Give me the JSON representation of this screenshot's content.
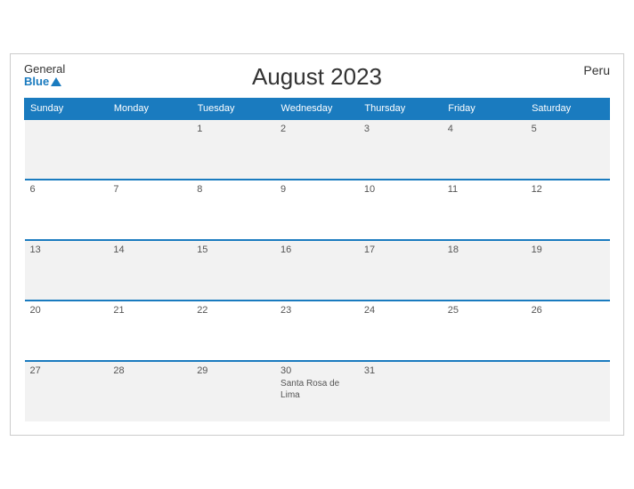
{
  "header": {
    "title": "August 2023",
    "country": "Peru",
    "logo_general": "General",
    "logo_blue": "Blue"
  },
  "weekdays": [
    "Sunday",
    "Monday",
    "Tuesday",
    "Wednesday",
    "Thursday",
    "Friday",
    "Saturday"
  ],
  "weeks": [
    [
      {
        "day": "",
        "event": ""
      },
      {
        "day": "",
        "event": ""
      },
      {
        "day": "1",
        "event": ""
      },
      {
        "day": "2",
        "event": ""
      },
      {
        "day": "3",
        "event": ""
      },
      {
        "day": "4",
        "event": ""
      },
      {
        "day": "5",
        "event": ""
      }
    ],
    [
      {
        "day": "6",
        "event": ""
      },
      {
        "day": "7",
        "event": ""
      },
      {
        "day": "8",
        "event": ""
      },
      {
        "day": "9",
        "event": ""
      },
      {
        "day": "10",
        "event": ""
      },
      {
        "day": "11",
        "event": ""
      },
      {
        "day": "12",
        "event": ""
      }
    ],
    [
      {
        "day": "13",
        "event": ""
      },
      {
        "day": "14",
        "event": ""
      },
      {
        "day": "15",
        "event": ""
      },
      {
        "day": "16",
        "event": ""
      },
      {
        "day": "17",
        "event": ""
      },
      {
        "day": "18",
        "event": ""
      },
      {
        "day": "19",
        "event": ""
      }
    ],
    [
      {
        "day": "20",
        "event": ""
      },
      {
        "day": "21",
        "event": ""
      },
      {
        "day": "22",
        "event": ""
      },
      {
        "day": "23",
        "event": ""
      },
      {
        "day": "24",
        "event": ""
      },
      {
        "day": "25",
        "event": ""
      },
      {
        "day": "26",
        "event": ""
      }
    ],
    [
      {
        "day": "27",
        "event": ""
      },
      {
        "day": "28",
        "event": ""
      },
      {
        "day": "29",
        "event": ""
      },
      {
        "day": "30",
        "event": "Santa Rosa de Lima"
      },
      {
        "day": "31",
        "event": ""
      },
      {
        "day": "",
        "event": ""
      },
      {
        "day": "",
        "event": ""
      }
    ]
  ]
}
